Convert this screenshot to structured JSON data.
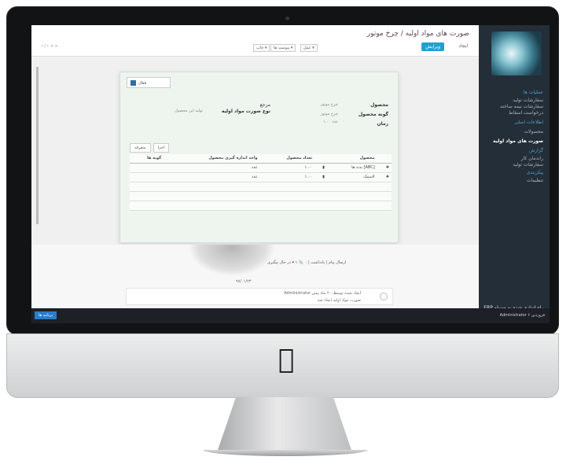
{
  "window": {
    "breadcrumb": "صورت های مواد اولیه / چرخ موتور"
  },
  "header": {
    "edit_label": "ویرایش",
    "create_label": "ایجاد",
    "btn_print": "چاپ ▾",
    "btn_attach": "پیوست ها ▾",
    "btn_action": "عمل ▾",
    "pager": "۱ / ۱  < >"
  },
  "sidebar": {
    "items": [
      {
        "label": "عملیات ها",
        "kind": "head"
      },
      {
        "label": "سفارشات تولید",
        "kind": "item"
      },
      {
        "label": "سفارشات نیمه ساخته",
        "kind": "item"
      },
      {
        "label": "درخواست اسقاط",
        "kind": "item"
      },
      {
        "label": "اطلاعات اصلی",
        "kind": "head"
      },
      {
        "label": "محصولات",
        "kind": "item"
      },
      {
        "label": "صورت های مواد اولیه",
        "kind": "active"
      },
      {
        "label": "گزارش",
        "kind": "head"
      },
      {
        "label": "راندمان کار",
        "kind": "item"
      },
      {
        "label": "سفارشات تولید",
        "kind": "item"
      },
      {
        "label": "پیکربندی",
        "kind": "head"
      },
      {
        "label": "تنظیمات",
        "kind": "item"
      }
    ],
    "footer": "ERP راه اندازی شده به وسیله"
  },
  "form": {
    "status_button": "فعال",
    "product_label": "محصول",
    "product_value": "چرخ موتور",
    "variant_label": "گونه محصول",
    "variant_value": "چرخ موتور",
    "quantity_label": "زمان",
    "quantity_value": "۱.۰۰ عدد",
    "reference_label": "مرجع",
    "bom_type_label": "نوع صورت مواد اولیه",
    "bom_type_value": "تولید این محصول",
    "tabs": [
      "اجزا",
      "متفرقه"
    ],
    "columns": [
      "محصول",
      "",
      "تعداد محصول",
      "واحد اندازه گیری محصول",
      "گونه ها"
    ],
    "rows": [
      {
        "product": "بدنه ها [ABC]",
        "qty": "۱.۰۰",
        "uom": "عدد",
        "variants": ""
      },
      {
        "product": "لاستیک",
        "qty": "۱.۰۰",
        "uom": "عدد",
        "variants": ""
      }
    ]
  },
  "chatter": {
    "attach_text": "ارسال پیام  |  یادداشت  |  ۰ 📎  ۱ ▾ در حال پیگیری",
    "date": "۹۷/۰۱/۲۳",
    "msg_line1": "Administrator  ایجاد شده توسط  -  ۲ ماه پیش",
    "msg_line2": "صورت مواد اولیه ایجاد شد"
  },
  "taskbar": {
    "left_label": "برنامه ها",
    "right_label": "Administrator  ۶ فروردین"
  }
}
